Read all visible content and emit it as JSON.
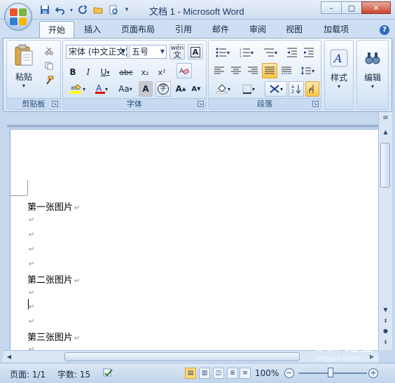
{
  "window": {
    "title": "文档 1 - Microsoft Word",
    "controls": {
      "minimize": "–",
      "restore": "▢",
      "close": "✕"
    }
  },
  "quick_access": [
    {
      "name": "save-icon",
      "glyph": "💾"
    },
    {
      "name": "undo-icon",
      "glyph": "↶"
    },
    {
      "name": "redo-icon",
      "glyph": "↻"
    },
    {
      "name": "open-icon",
      "glyph": "📂"
    },
    {
      "name": "print-preview-icon",
      "glyph": "🔍"
    },
    {
      "name": "customize-icon",
      "glyph": "▾"
    }
  ],
  "tabs": [
    "开始",
    "插入",
    "页面布局",
    "引用",
    "邮件",
    "审阅",
    "视图",
    "加载项"
  ],
  "help": "?",
  "ribbon": {
    "clipboard": {
      "label": "剪贴板",
      "paste": "粘贴"
    },
    "font": {
      "label": "字体",
      "font_name": "宋体 (中文正文)",
      "font_size": "五号",
      "bold": "B",
      "italic": "I",
      "underline": "U",
      "strike": "abc",
      "subscript": "x₂",
      "superscript": "x²",
      "change_case": "Aa",
      "grow": "A",
      "shrink": "A",
      "phonetic": "wén"
    },
    "paragraph": {
      "label": "段落"
    },
    "styles": {
      "label": "样式"
    },
    "editing": {
      "label": "编辑"
    }
  },
  "document": {
    "lines": [
      {
        "text": "第一张图片",
        "mark": "↵"
      },
      {
        "text": "",
        "mark": "↵"
      },
      {
        "text": "",
        "mark": "↵"
      },
      {
        "text": "",
        "mark": "↵"
      },
      {
        "text": "",
        "mark": "↵"
      },
      {
        "text": "第二张图片",
        "mark": "↵"
      },
      {
        "text": "",
        "mark": "↵"
      },
      {
        "text": "",
        "mark": "↵"
      },
      {
        "text": "",
        "mark": "↵"
      },
      {
        "text": "第三张图片",
        "mark": "↵"
      },
      {
        "text": "",
        "mark": "↵"
      }
    ]
  },
  "status": {
    "page": "页面: 1/1",
    "words": "字数: 15",
    "zoom": "100%"
  },
  "watermark": {
    "brand": "Bai 经验",
    "url": "jingyan.baidu.com"
  }
}
